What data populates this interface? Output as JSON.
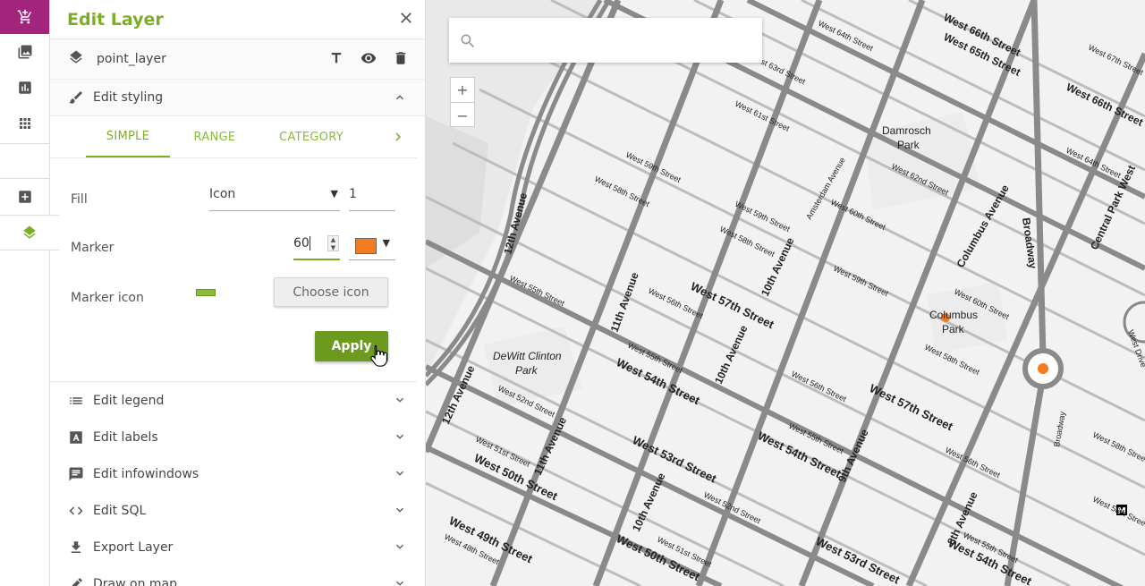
{
  "panel": {
    "title": "Edit Layer",
    "layer_name": "point_layer"
  },
  "sections": {
    "styling": "Edit styling",
    "legend": "Edit legend",
    "labels": "Edit labels",
    "infowindows": "Edit infowindows",
    "sql": "Edit SQL",
    "export": "Export Layer",
    "draw": "Draw on map"
  },
  "tabs": {
    "simple": "SIMPLE",
    "range": "RANGE",
    "category": "CATEGORY"
  },
  "form": {
    "fill_label": "Fill",
    "fill_value": "Icon",
    "fill_opacity": "1",
    "marker_label": "Marker",
    "marker_size": "60",
    "marker_color": "#f47b20",
    "marker_icon_label": "Marker icon",
    "choose_icon_button": "Choose icon",
    "apply_button": "Apply"
  },
  "map": {
    "search_placeholder": "",
    "zoom_in": "+",
    "zoom_out": "−",
    "labels": {
      "w64": "West 64th Street",
      "w66": "West 66th Street",
      "w65": "West 65th Street",
      "w63": "West 63rd Street",
      "w61": "West 61st Street",
      "w67": "West 67th Street",
      "w66b": "West 66th Street",
      "w59": "West 59th Street",
      "w58": "West 58th Street",
      "damrosch": "Damrosch Park",
      "w62": "West 62nd Street",
      "w64b": "West 64th Street",
      "amsterdam": "Amsterdam Avenue",
      "w60": "West 60th Street",
      "columbus": "Columbus Avenue",
      "broadway": "Broadway",
      "cpw": "Central Park West",
      "w59b": "West 59th Street",
      "w58b": "West 58th Street",
      "ave10": "10th Avenue",
      "ave12": "12th Avenue",
      "w55": "West 55th Street",
      "ave11": "11th Avenue",
      "w56": "West 56th Street",
      "w57": "West 57th Street",
      "w59c": "West 59th Street",
      "w60b": "West 60th Street",
      "colpark": "Columbus Park",
      "w58c": "West 58th Street",
      "dewitt": "DeWitt Clinton Park",
      "w55b": "West 55th Street",
      "w54": "West 54th Street",
      "ave10b": "10th Avenue",
      "w56b": "West 56th Street",
      "w57b": "West 57th Street",
      "w52": "West 52nd Street",
      "ave12b": "12th Avenue",
      "ave11b": "11th Avenue",
      "w51": "West 51st Street",
      "w50": "West 50th Street",
      "w53": "West 53rd Street",
      "w54b": "West 54th Street",
      "w55c": "West 55th Street",
      "ave9": "9th Avenue",
      "w56c": "West 56th Street",
      "broadwayb": "Broadway",
      "w58d": "West 58th Street",
      "w52b": "West 52nd Street",
      "w49": "West 49th Street",
      "w48": "West 48th Street",
      "ave10c": "10th Avenue",
      "w50b": "West 50th Street",
      "w51b": "West 51st Street",
      "w53b": "West 53rd Street",
      "ave8": "8th Avenue",
      "w55d": "West 55th Street",
      "w54c": "West 54th Street",
      "w56d": "West 56th Street",
      "w57c": "West 57th Street",
      "w56e": "West 56th Street",
      "wdrive": "West Drive",
      "metro": "M"
    }
  }
}
